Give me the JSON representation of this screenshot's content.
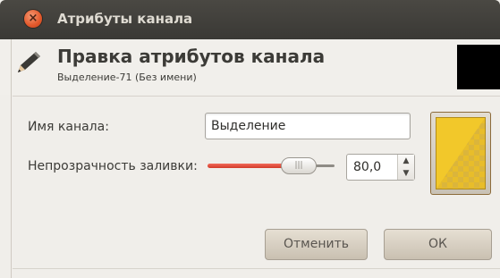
{
  "window": {
    "title": "Атрибуты канала",
    "close_icon": "close-icon"
  },
  "header": {
    "icon": "pencil-icon",
    "heading": "Правка атрибутов канала",
    "subheading": "Выделение-71 (Без имени)",
    "preview_color": "#000000"
  },
  "form": {
    "name_label": "Имя канала:",
    "name_value": "Выделение",
    "opacity_label": "Непрозрачность заливки:",
    "opacity_value": "80,0",
    "opacity_fraction": 0.8,
    "swatch_color": "#f2c82a"
  },
  "buttons": {
    "cancel": "Отменить",
    "ok": "ОК"
  },
  "colors": {
    "titlebar": "#3c3b37",
    "slider_accent": "#e0503d",
    "close_button": "#e2572a"
  }
}
